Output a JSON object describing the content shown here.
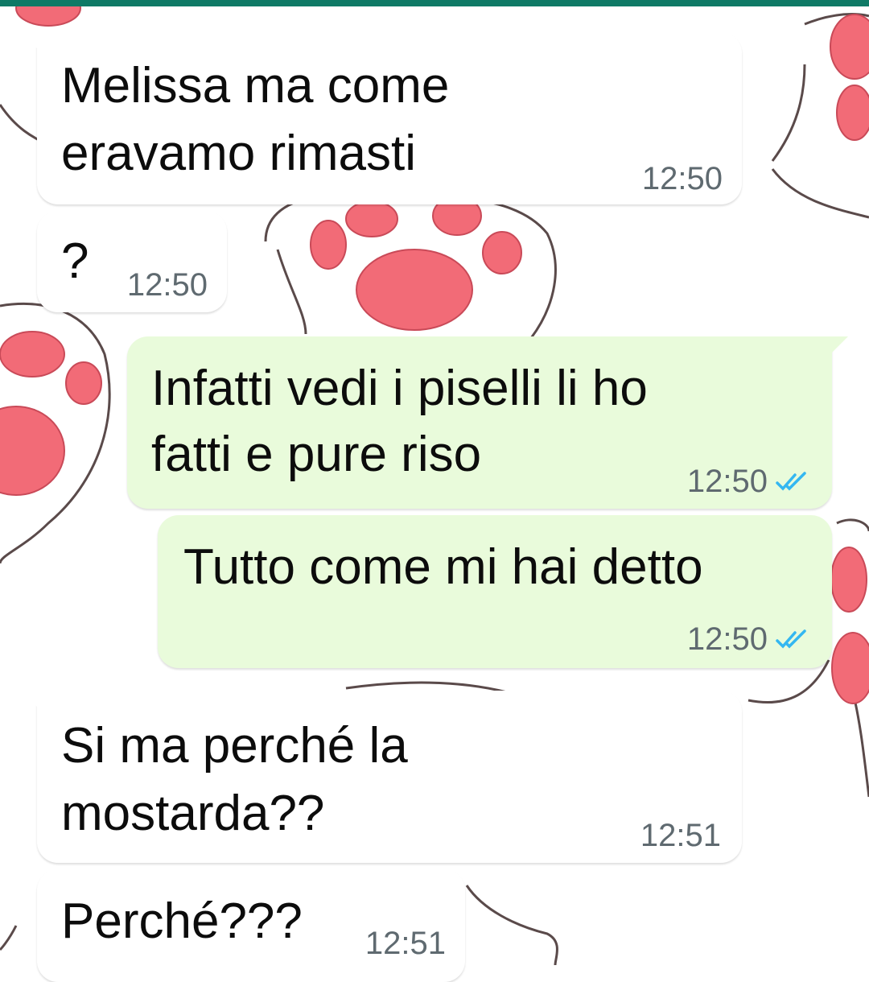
{
  "theme": {
    "header_color": "#0f7a66",
    "incoming_bg": "#ffffff",
    "outgoing_bg": "#e9fbdb",
    "read_tick_color": "#34b7f1",
    "wallpaper": "pink-cat-paws"
  },
  "messages": [
    {
      "direction": "incoming",
      "lines": [
        "Melissa ma come",
        "eravamo rimasti"
      ],
      "time": "12:50"
    },
    {
      "direction": "incoming",
      "lines": [
        "?"
      ],
      "time": "12:50"
    },
    {
      "direction": "outgoing",
      "lines": [
        "Infatti vedi i piselli li ho",
        "fatti e pure riso"
      ],
      "time": "12:50",
      "status_icon": "double-check-read-icon"
    },
    {
      "direction": "outgoing",
      "lines": [
        "Tutto come mi hai detto"
      ],
      "time": "12:50",
      "status_icon": "double-check-read-icon"
    },
    {
      "direction": "incoming",
      "lines": [
        "Si ma perché la",
        "mostarda??"
      ],
      "time": "12:51"
    },
    {
      "direction": "incoming",
      "lines": [
        "Perché???"
      ],
      "time": "12:51"
    }
  ]
}
